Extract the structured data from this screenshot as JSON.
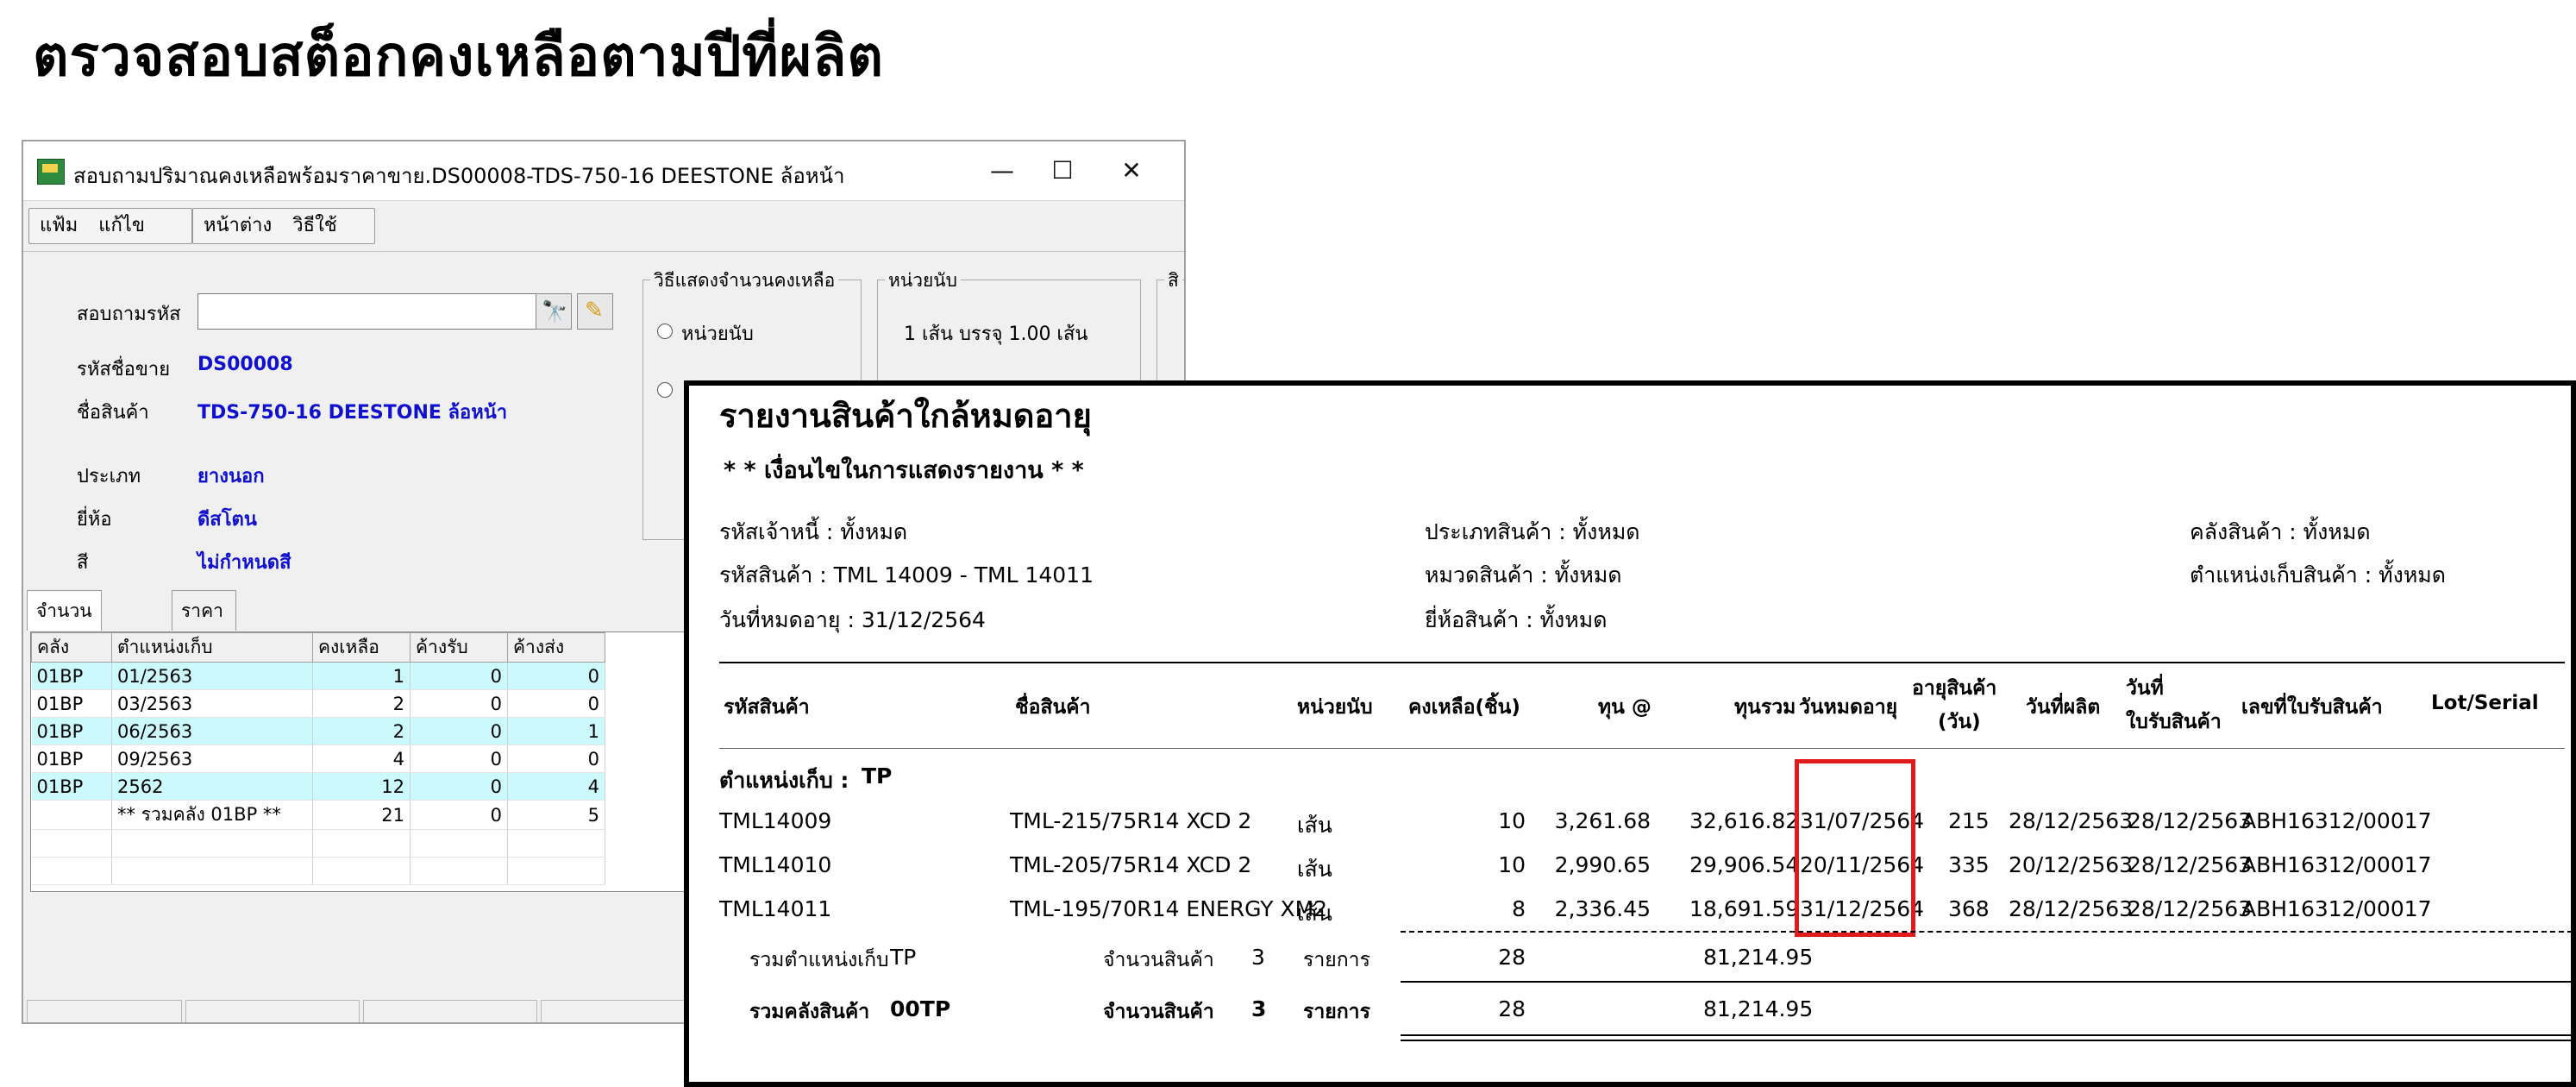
{
  "page_title": "ตรวจสอบสต็อกคงเหลือตามปีที่ผลิต",
  "window": {
    "title": "สอบถามปริมาณคงเหลือพร้อมราคาขาย.DS00008-TDS-750-16 DEESTONE ล้อหน้า",
    "controls": {
      "minimize": "—",
      "maximize": "☐",
      "close": "✕"
    },
    "menu": [
      "แฟ้ม",
      "แก้ไข",
      "หน้าต่าง",
      "วิธีใช้"
    ],
    "search_label": "สอบถามรหัส",
    "search_value": "",
    "fields": [
      {
        "label": "รหัสชื่อขาย",
        "value": "DS00008"
      },
      {
        "label": "ชื่อสินค้า",
        "value": "TDS-750-16  DEESTONE  ล้อหน้า"
      },
      {
        "label": "ประเภท",
        "value": "ยางนอก"
      },
      {
        "label": "ยี่ห้อ",
        "value": "ดีสโตน"
      },
      {
        "label": "สี",
        "value": "ไม่กำหนดสี"
      }
    ],
    "group_display": {
      "title": "วิธีแสดงจำนวนคงเหลือ",
      "option1": "หน่วยนับ"
    },
    "group_unit": {
      "title": "หน่วยนับ",
      "text": "1 เส้น บรรจุ 1.00 เส้น"
    },
    "group_third_title": "สิ",
    "tabs": [
      "จำนวนคงเหลือ",
      "ราคาขายสินค้า"
    ],
    "grid": {
      "columns": [
        "คลัง",
        "ตำแหน่งเก็บ",
        "คงเหลือ",
        "ค้างรับ",
        "ค้างส่ง"
      ],
      "rows": [
        {
          "wh": "01BP",
          "loc": "01/2563",
          "bal": "1",
          "rcv": "0",
          "snd": "0",
          "hl": true
        },
        {
          "wh": "01BP",
          "loc": "03/2563",
          "bal": "2",
          "rcv": "0",
          "snd": "0",
          "hl": false
        },
        {
          "wh": "01BP",
          "loc": "06/2563",
          "bal": "2",
          "rcv": "0",
          "snd": "1",
          "hl": true
        },
        {
          "wh": "01BP",
          "loc": "09/2563",
          "bal": "4",
          "rcv": "0",
          "snd": "0",
          "hl": false
        },
        {
          "wh": "01BP",
          "loc": "2562",
          "bal": "12",
          "rcv": "0",
          "snd": "4",
          "hl": true
        },
        {
          "wh": "",
          "loc": "** รวมคลัง 01BP **",
          "bal": "21",
          "rcv": "0",
          "snd": "5",
          "hl": false
        }
      ]
    }
  },
  "report": {
    "title": "รายงานสินค้าใกล้หมดอายุ",
    "conditions_title": "* * เงื่อนไขในการแสดงรายงาน * *",
    "conditions": {
      "creditor": "รหัสเจ้าหนี้ : ทั้งหมด",
      "product_code": "รหัสสินค้า : TML 14009  - TML 14011",
      "expiry": "วันที่หมดอายุ :   31/12/2564",
      "product_type": "ประเภทสินค้า : ทั้งหมด",
      "category": "หมวดสินค้า : ทั้งหมด",
      "brand": "ยี่ห้อสินค้า : ทั้งหมด",
      "warehouse": "คลังสินค้า : ทั้งหมด",
      "location": "ตำแหน่งเก็บสินค้า : ทั้งหมด"
    },
    "headers": {
      "code": "รหัสสินค้า",
      "name": "ชื่อสินค้า",
      "unit": "หน่วยนับ",
      "qty": "คงเหลือ(ชิ้น)",
      "cost": "ทุน @",
      "total": "ทุนรวม",
      "expiry": "วันหมดอายุ",
      "age1": "อายุสินค้า",
      "age2": "(วัน)",
      "mfg": "วันที่ผลิต",
      "rcv1": "วันที่",
      "rcv2": "ใบรับสินค้า",
      "doc": "เลขที่ใบรับสินค้า",
      "lot": "Lot/Serial"
    },
    "location_label": "ตำแหน่งเก็บ :",
    "location_value": "TP",
    "rows": [
      {
        "code": "TML14009",
        "name": "TML-215/75R14  XCD 2",
        "unit": "เส้น",
        "qty": "10",
        "cost": "3,261.68",
        "total": "32,616.82",
        "expiry": "31/07/2564",
        "age": "215",
        "mfg": "28/12/2563",
        "rcv": "28/12/2563",
        "doc": "ABH16312/00017"
      },
      {
        "code": "TML14010",
        "name": "TML-205/75R14  XCD 2",
        "unit": "เส้น",
        "qty": "10",
        "cost": "2,990.65",
        "total": "29,906.54",
        "expiry": "20/11/2564",
        "age": "335",
        "mfg": "20/12/2563",
        "rcv": "28/12/2563",
        "doc": "ABH16312/00017"
      },
      {
        "code": "TML14011",
        "name": "TML-195/70R14 ENERGY  XM2",
        "unit": "เส้น",
        "qty": "8",
        "cost": "2,336.45",
        "total": "18,691.59",
        "expiry": "31/12/2564",
        "age": "368",
        "mfg": "28/12/2563",
        "rcv": "28/12/2563",
        "doc": "ABH16312/00017"
      }
    ],
    "subtotal": {
      "label": "รวมตำแหน่งเก็บ",
      "code": "TP",
      "count_label": "จำนวนสินค้า",
      "count": "3",
      "unit": "รายการ",
      "qty": "28",
      "total": "81,214.95"
    },
    "grandtotal": {
      "label": "รวมคลังสินค้า",
      "code": "00TP",
      "count_label": "จำนวนสินค้า",
      "count": "3",
      "unit": "รายการ",
      "qty": "28",
      "total": "81,214.95"
    }
  }
}
